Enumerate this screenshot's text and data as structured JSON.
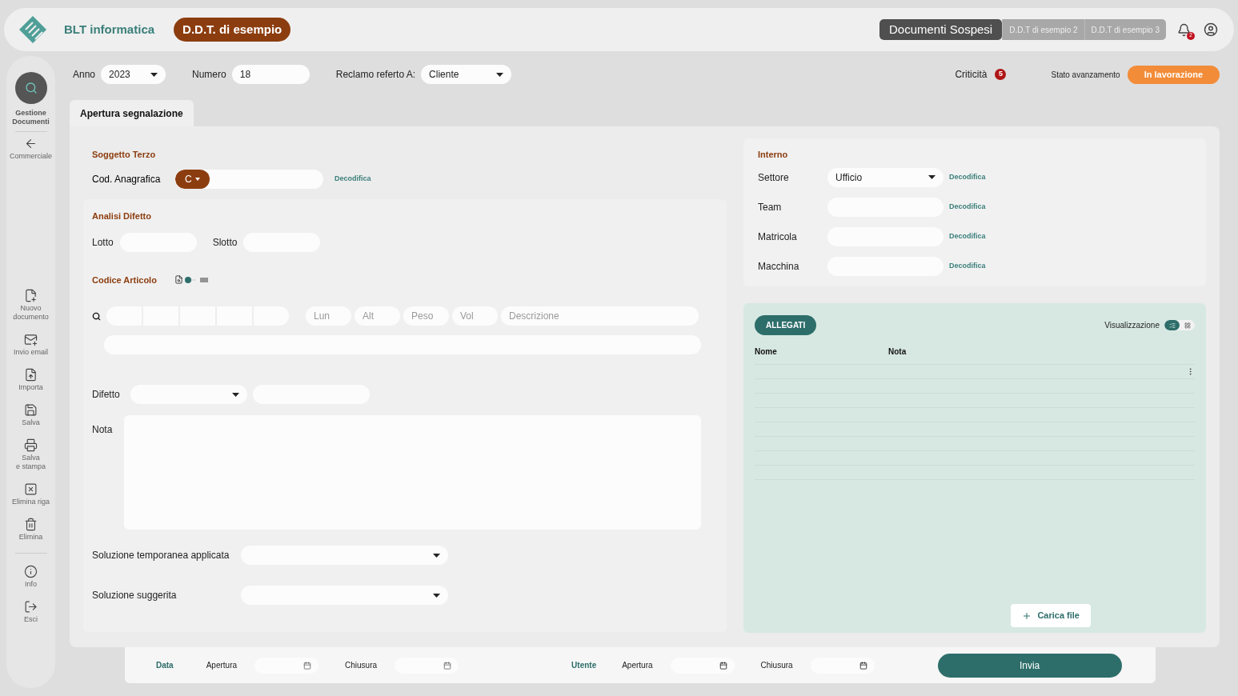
{
  "header": {
    "brand": "BLT informatica",
    "document_pill": "D.D.T. di esempio",
    "doc_tabs": [
      {
        "label": "Documenti Sospesi",
        "selected": true
      },
      {
        "label": "D.D.T di esempio 2",
        "selected": false
      },
      {
        "label": "D.D.T di esempio 3",
        "selected": false
      }
    ],
    "notification_count": "2"
  },
  "sidebar": {
    "top": {
      "label": "Gestione\nDocumenti"
    },
    "back": {
      "label": "Commerciale"
    },
    "actions": [
      {
        "label": "Nuovo\ndocumento"
      },
      {
        "label": "Invio email"
      },
      {
        "label": "Importa"
      },
      {
        "label": "Salva"
      },
      {
        "label": "Salva\ne stampa"
      },
      {
        "label": "Elimina riga"
      },
      {
        "label": "Elimina"
      }
    ],
    "bottom": [
      {
        "label": "Info"
      },
      {
        "label": "Esci"
      }
    ]
  },
  "toolbar": {
    "anno": {
      "label": "Anno",
      "value": "2023"
    },
    "numero": {
      "label": "Numero",
      "value": "18"
    },
    "reclamo": {
      "label": "Reclamo referto A:",
      "value": "Cliente"
    },
    "criticita": {
      "label": "Criticità",
      "count": "5"
    },
    "stato": {
      "label": "Stato avanzamento",
      "value": "In lavorazione"
    }
  },
  "tabs": [
    {
      "label": "Apertura segnalazione",
      "selected": true
    }
  ],
  "soggetto": {
    "title": "Soggetto Terzo",
    "label": "Cod. Anagrafica",
    "prefix": "C",
    "link": "Decodifica"
  },
  "analisi": {
    "title": "Analisi Difetto",
    "lotto": "Lotto",
    "slotto": "Slotto",
    "codice_title": "Codice Articolo",
    "measure_placeholders": [
      "Lun",
      "Alt",
      "Peso",
      "Vol"
    ],
    "description_placeholder": "Descrizione",
    "difetto": "Difetto",
    "nota": "Nota",
    "soluzione_temporanea": "Soluzione temporanea applicata",
    "soluzione_suggerita": "Soluzione suggerita"
  },
  "interno": {
    "title": "Interno",
    "rows": [
      {
        "label": "Settore",
        "kind": "select",
        "value": "Ufficio",
        "link": "Decodifica"
      },
      {
        "label": "Team",
        "kind": "input",
        "link": "Decodifica"
      },
      {
        "label": "Matricola",
        "kind": "input",
        "link": "Decodifica"
      },
      {
        "label": "Macchina",
        "kind": "input",
        "link": "Decodifica"
      }
    ]
  },
  "allegati": {
    "button": "ALLEGATI",
    "view_label": "Visualizzazione",
    "view_modes": [
      {
        "selected": true
      },
      {
        "selected": false
      }
    ],
    "columns": [
      "Nome",
      "Nota"
    ],
    "upload": "Carica file"
  },
  "footer": {
    "data": "Data",
    "data_open": "Apertura",
    "data_close": "Chiusura",
    "utente": "Utente",
    "utente_open": "Apertura",
    "utente_close": "Chiusura",
    "submit": "Invia"
  }
}
